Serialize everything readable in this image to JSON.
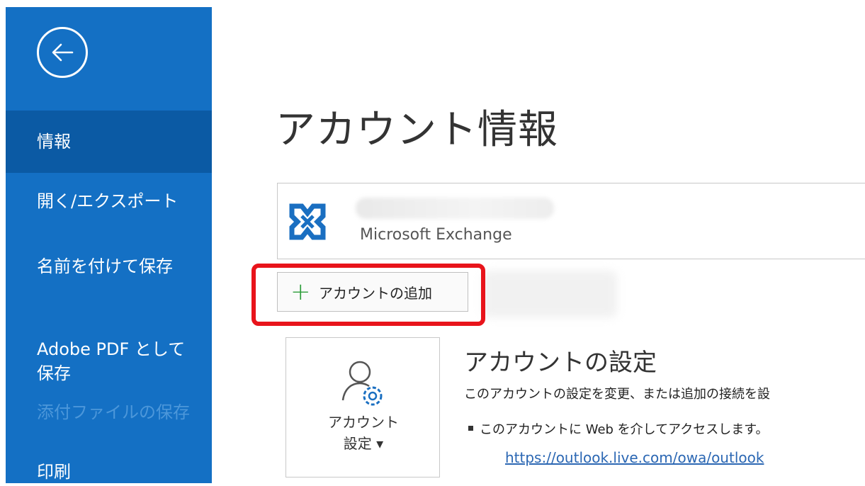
{
  "sidebar": {
    "items": [
      {
        "label": "情報"
      },
      {
        "label": "開く/エクスポート"
      },
      {
        "label": "名前を付けて保存"
      },
      {
        "label": "Adobe PDF として\n保存"
      },
      {
        "label": "添付ファイルの保存"
      },
      {
        "label": "印刷"
      }
    ]
  },
  "main": {
    "title": "アカウント情報",
    "account": {
      "type": "Microsoft Exchange"
    },
    "add_account_label": "アカウントの追加",
    "settings_tile": {
      "line1": "アカウント",
      "line2": "設定 ▾"
    },
    "section_title": "アカウントの設定",
    "section_desc": "このアカウントの設定を変更、または追加の接続を設",
    "bullet": "このアカウントに Web を介してアクセスします。",
    "link": "https://outlook.live.com/owa/outlook"
  },
  "colors": {
    "sidebar": "#1470c4",
    "sidebar_active": "#0b5aa4",
    "highlight": "#e8141b",
    "plus": "#2d9d3a",
    "link": "#2b67b3"
  },
  "icons": [
    "back-arrow-icon",
    "exchange-logo-icon",
    "account-settings-icon",
    "plus-icon"
  ]
}
